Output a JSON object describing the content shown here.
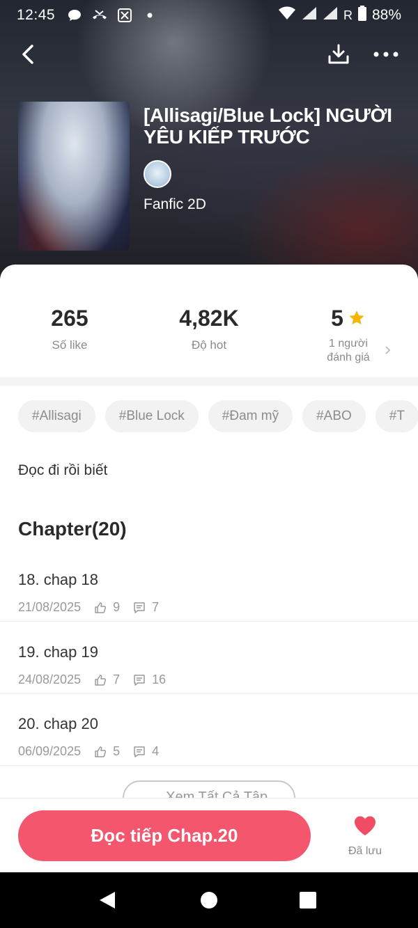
{
  "status_bar": {
    "time": "12:45",
    "battery": "88%",
    "network_letter": "R",
    "icons": [
      "chat-bubble-icon",
      "missed-call-icon",
      "app-icon",
      "dot-icon",
      "wifi-icon",
      "signal-icon",
      "signal-icon",
      "battery-icon"
    ]
  },
  "top_nav": {
    "back_icon": "back-arrow-icon",
    "download_icon": "download-icon",
    "more_icon": "more-dots-icon"
  },
  "story": {
    "title": "[Allisagi/Blue Lock] NGƯỜI YÊU KIẾP TRƯỚC",
    "genre": "Fanfic 2D"
  },
  "stats": {
    "likes_value": "265",
    "likes_label": "Số like",
    "hot_value": "4,82K",
    "hot_label": "Độ hot",
    "rating_value": "5",
    "rating_label_line1": "1 người",
    "rating_label_line2": "đánh giá"
  },
  "tags": [
    "#Allisagi",
    "#Blue Lock",
    "#Đam mỹ",
    "#ABO",
    "#T"
  ],
  "description": "Đọc đi rồi biết",
  "chapters_heading": "Chapter(20)",
  "chapters": [
    {
      "title": "18. chap 18",
      "date": "21/08/2025",
      "likes": "9",
      "comments": "7"
    },
    {
      "title": "19. chap 19",
      "date": "24/08/2025",
      "likes": "7",
      "comments": "16"
    },
    {
      "title": "20. chap 20",
      "date": "06/09/2025",
      "likes": "5",
      "comments": "4"
    }
  ],
  "see_all_label": "⌄ Xem Tất Cả Tập",
  "bottom": {
    "read_button": "Đọc tiếp Chap.20",
    "saved_label": "Đã lưu"
  },
  "colors": {
    "accent": "#f4566e",
    "star": "#f7b500",
    "heart": "#f04d65"
  }
}
